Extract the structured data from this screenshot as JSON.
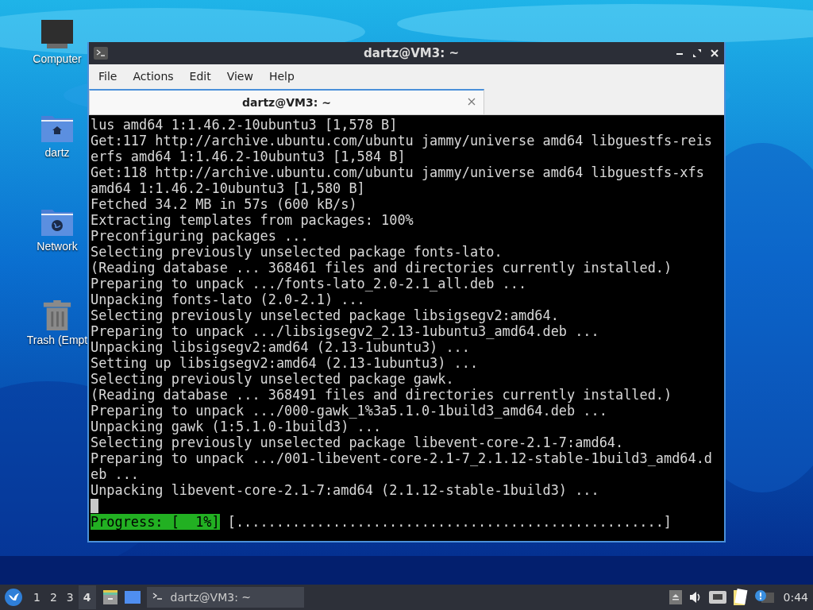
{
  "desktop_icons": [
    {
      "kind": "computer",
      "label": "Computer"
    },
    {
      "kind": "home",
      "label": "dartz"
    },
    {
      "kind": "network",
      "label": "Network"
    },
    {
      "kind": "trash",
      "label": "Trash (Empt"
    }
  ],
  "window": {
    "title": "dartz@VM3: ~",
    "menu": [
      "File",
      "Actions",
      "Edit",
      "View",
      "Help"
    ],
    "tabs": [
      {
        "label": "dartz@VM3: ~",
        "selected": true
      }
    ],
    "terminal": {
      "lines": [
        "lus amd64 1:1.46.2-10ubuntu3 [1,578 B]",
        "Get:117 http://archive.ubuntu.com/ubuntu jammy/universe amd64 libguestfs-reis",
        "erfs amd64 1:1.46.2-10ubuntu3 [1,584 B]",
        "Get:118 http://archive.ubuntu.com/ubuntu jammy/universe amd64 libguestfs-xfs",
        "amd64 1:1.46.2-10ubuntu3 [1,580 B]",
        "Fetched 34.2 MB in 57s (600 kB/s)",
        "Extracting templates from packages: 100%",
        "Preconfiguring packages ...",
        "Selecting previously unselected package fonts-lato.",
        "(Reading database ... 368461 files and directories currently installed.)",
        "Preparing to unpack .../fonts-lato_2.0-2.1_all.deb ...",
        "Unpacking fonts-lato (2.0-2.1) ...",
        "Selecting previously unselected package libsigsegv2:amd64.",
        "Preparing to unpack .../libsigsegv2_2.13-1ubuntu3_amd64.deb ...",
        "Unpacking libsigsegv2:amd64 (2.13-1ubuntu3) ...",
        "Setting up libsigsegv2:amd64 (2.13-1ubuntu3) ...",
        "Selecting previously unselected package gawk.",
        "(Reading database ... 368491 files and directories currently installed.)",
        "Preparing to unpack .../000-gawk_1%3a5.1.0-1build3_amd64.deb ...",
        "Unpacking gawk (1:5.1.0-1build3) ...",
        "Selecting previously unselected package libevent-core-2.1-7:amd64.",
        "Preparing to unpack .../001-libevent-core-2.1-7_2.1.12-stable-1build3_amd64.d",
        "eb ...",
        "Unpacking libevent-core-2.1-7:amd64 (2.1.12-stable-1build3) ..."
      ],
      "progress_label": "Progress: [  1%]",
      "progress_bar": "[.....................................................]"
    }
  },
  "taskbar": {
    "workspaces": [
      {
        "label": "1",
        "selected": false
      },
      {
        "label": "2",
        "selected": false
      },
      {
        "label": "3",
        "selected": false
      },
      {
        "label": "4",
        "selected": true
      }
    ],
    "tasks": [
      {
        "label": "dartz@VM3: ~",
        "selected": true
      }
    ],
    "clock": "0:44"
  }
}
